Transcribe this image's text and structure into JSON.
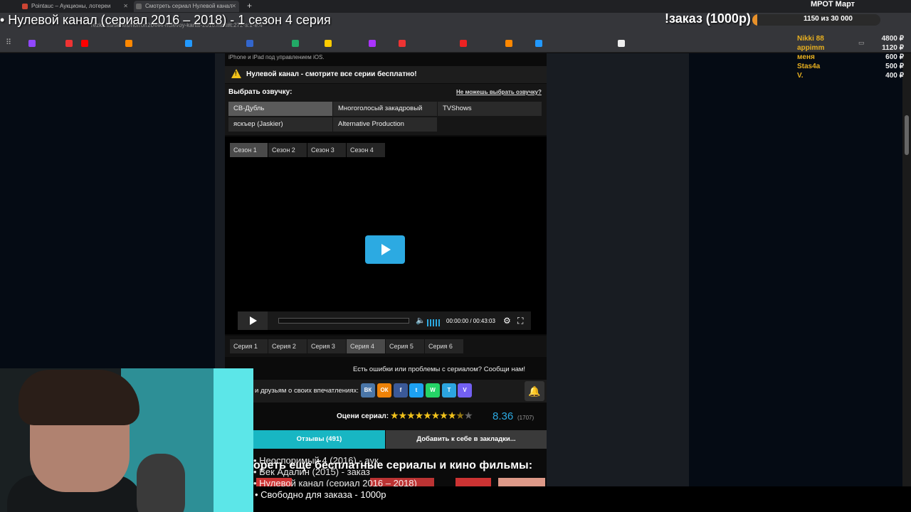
{
  "browser": {
    "tabs": [
      {
        "label": "Pointauc – Аукционы, лотереи"
      },
      {
        "label": "Смотреть сериал Нулевой канал"
      }
    ],
    "url": "rezka.ss/series/horror/20444-nulevoy-kanal-2016.html#t:272-s:1-e:4"
  },
  "stream": {
    "title": "• Нулевой канал (сериал 2016 – 2018) - 1 сезон 4 серия",
    "order_title": "!заказ (1000р)",
    "order_progress_text": "1150  из 30 000",
    "order_progress_value": 0.038,
    "mrot": "МРОТ Март",
    "donors": [
      {
        "name": "Nikki 88",
        "amount": "4800 ₽"
      },
      {
        "name": "appimm",
        "amount": "1120 ₽"
      },
      {
        "name": "меня",
        "amount": "600 ₽"
      },
      {
        "name": "Stas4a",
        "amount": "500 ₽"
      },
      {
        "name": "V.",
        "amount": "400 ₽"
      }
    ],
    "subs_lines": [
      "• Неоспоримый 4 (2016) - аук",
      "• Век Адалин (2015) - заказ",
      "• Нулевой канал (сериал 2016 – 2018)"
    ],
    "sub_bottom": "• Свободно для заказа - 1000р"
  },
  "page": {
    "ios_line": "iPhone и iPad под управлением iOS.",
    "notice": "Нулевой канал - смотрите все серии бесплатно!",
    "voice_title": "Выбрать озвучку:",
    "voice_help": "Не можешь выбрать озвучку?",
    "voices": [
      "СВ-Дубль",
      "Многоголосый закадровый",
      "TVShows",
      "яскъер (Jaskier)",
      "Alternative Production"
    ],
    "seasons": [
      "Сезон 1",
      "Сезон 2",
      "Сезон 3",
      "Сезон 4"
    ],
    "episodes": [
      "Серия 1",
      "Серия 2",
      "Серия 3",
      "Серия 4",
      "Серия 5",
      "Серия 6"
    ],
    "player_time": "00:00:00  /  00:43:03",
    "report": "Есть ошибки или проблемы с сериалом? Сообщи нам!",
    "share": "и друзьям о своих впечатлениях:",
    "social": [
      "ВК",
      "ОК",
      "f",
      "t",
      "W",
      "T",
      "V"
    ],
    "rate_label": "Оцени сериал:",
    "rating": "8.36",
    "rating_count": "(1707)",
    "reviews": "Отзывы (491)",
    "bookmark": "Добавить к себе в закладки...",
    "more_title": "ореть еще бесплатные сериалы и кино фильмы:"
  },
  "colors": {
    "accent": "#2caae2",
    "reviews_bg": "#18b6c3",
    "star": "#f1c21b",
    "order": "#e8912a",
    "donor_name": "#e8b020"
  },
  "icons": [
    "warning-icon",
    "play-icon",
    "volume-icon",
    "gear-icon",
    "fullscreen-icon",
    "bell-icon"
  ]
}
